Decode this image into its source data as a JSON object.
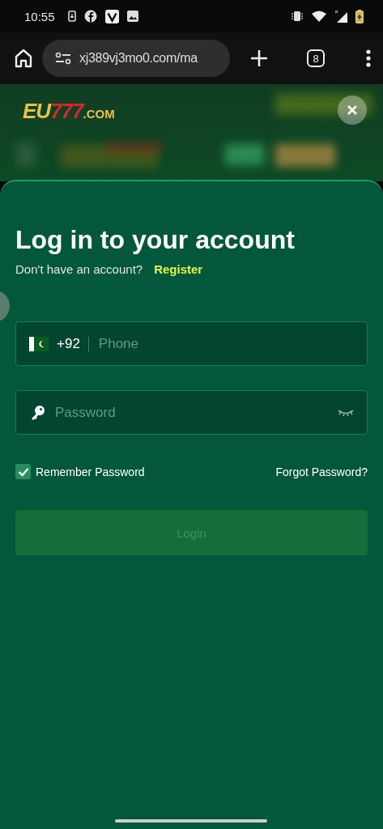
{
  "status_bar": {
    "time": "10:55"
  },
  "browser": {
    "url": "xj389vj3mo0.com/ma",
    "tab_count": "8"
  },
  "header": {
    "logo": [
      {
        "kind": "brand",
        "text": "EU"
      },
      {
        "kind": "number",
        "text": "777"
      },
      {
        "kind": "domain",
        "text": ".COM"
      }
    ]
  },
  "login": {
    "title": "Log in to your account",
    "prompt": "Don't have an account?",
    "register_link": "Register",
    "phone": {
      "country_code": "+92",
      "placeholder": "Phone"
    },
    "password": {
      "placeholder": "Password"
    },
    "remember": {
      "label": "Remember Password",
      "checked": true
    },
    "forgot_link": "Forgot Password?",
    "submit": {
      "label": "Login",
      "disabled": true
    }
  }
}
